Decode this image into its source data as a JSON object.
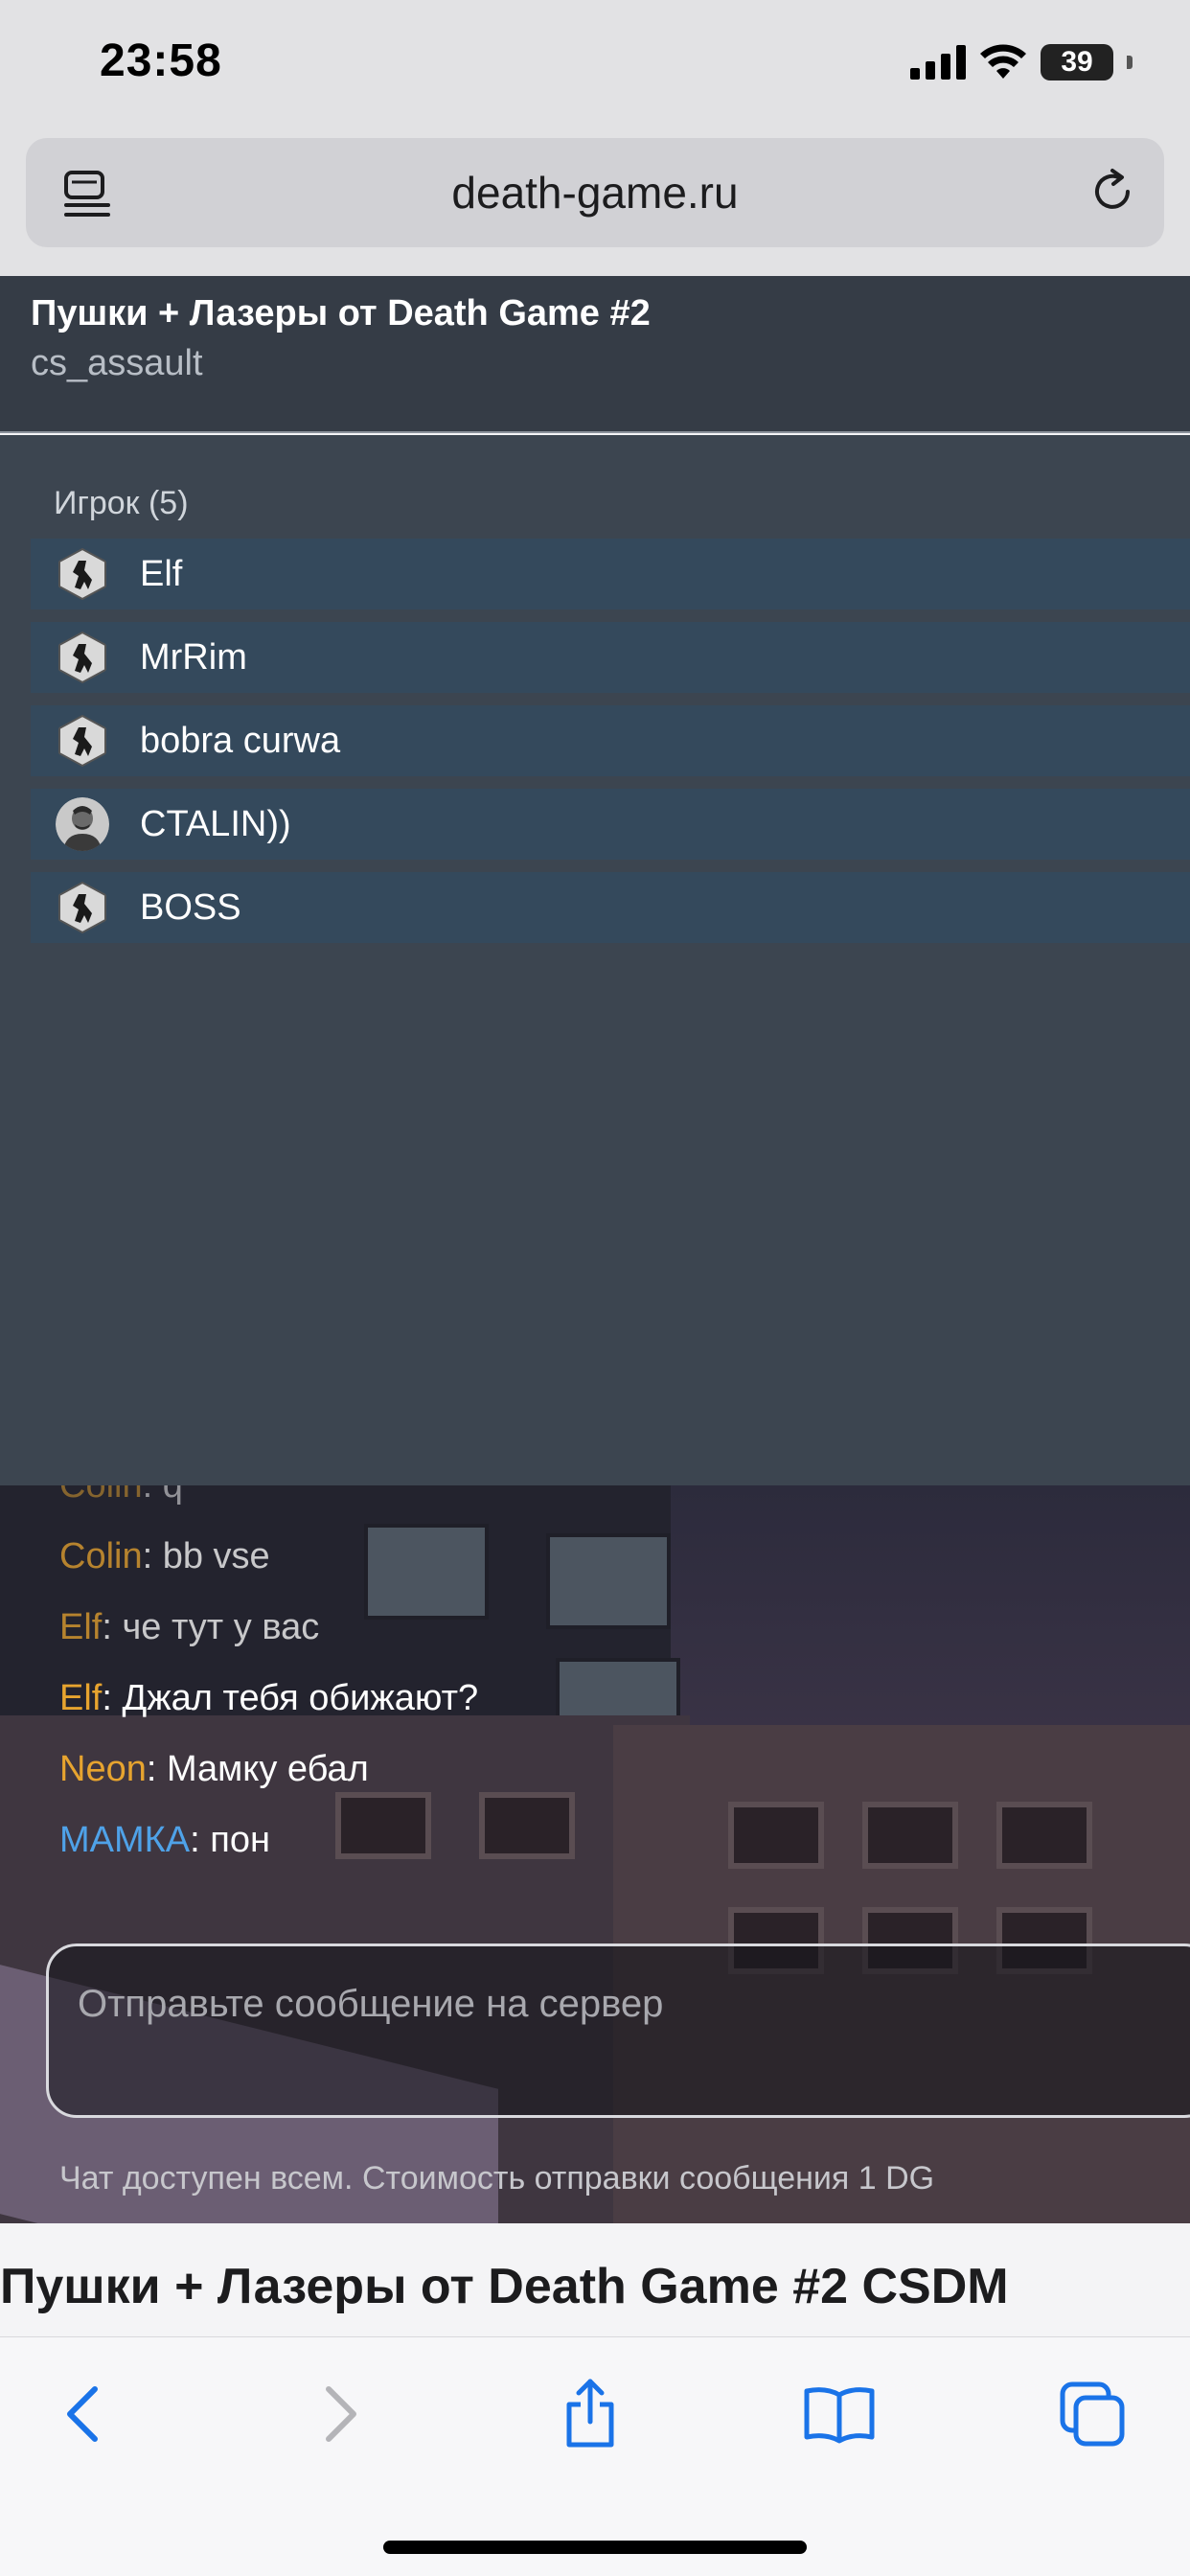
{
  "status_bar": {
    "time": "23:58",
    "battery": "39",
    "icons": [
      "signal-icon",
      "wifi-icon",
      "battery-icon"
    ]
  },
  "browser": {
    "url": "death-game.ru"
  },
  "server": {
    "title": "Пушки + Лазеры от Death Game #2",
    "map": "cs_assault"
  },
  "players": {
    "heading": "Игрок (5)",
    "items": [
      {
        "name": "Elf",
        "avatar": "cs-logo-icon"
      },
      {
        "name": "MrRim",
        "avatar": "cs-logo-icon"
      },
      {
        "name": "bobra curwa",
        "avatar": "cs-logo-icon"
      },
      {
        "name": "CTALIN))",
        "avatar": "portrait-avatar"
      },
      {
        "name": "BOSS",
        "avatar": "cs-logo-icon"
      }
    ]
  },
  "chat": {
    "messages": [
      {
        "author": "Colin",
        "text": ": q"
      },
      {
        "author": "Colin",
        "text": ": bb vse"
      },
      {
        "author": "Elf",
        "text": ": че тут у вас"
      },
      {
        "author": "Elf",
        "text": ": Джал тебя обижают?"
      },
      {
        "author": "Neon",
        "text": ": Мамку ебал"
      },
      {
        "author": "МАМКА",
        "text": ": пон"
      }
    ],
    "input_placeholder": "Отправьте сообщение на сервер",
    "note": "Чат доступен всем. Стоимость отправки сообщения 1 DG",
    "author_colors": {
      "default": "#e7a42f",
      "highlight": "#4fa2e8"
    }
  },
  "page": {
    "heading": "Пушки + Лазеры от Death Game #2 CSDM"
  },
  "toolbar": {
    "buttons": [
      "back-icon",
      "forward-icon",
      "share-icon",
      "bookmarks-icon",
      "tabs-icon"
    ]
  }
}
